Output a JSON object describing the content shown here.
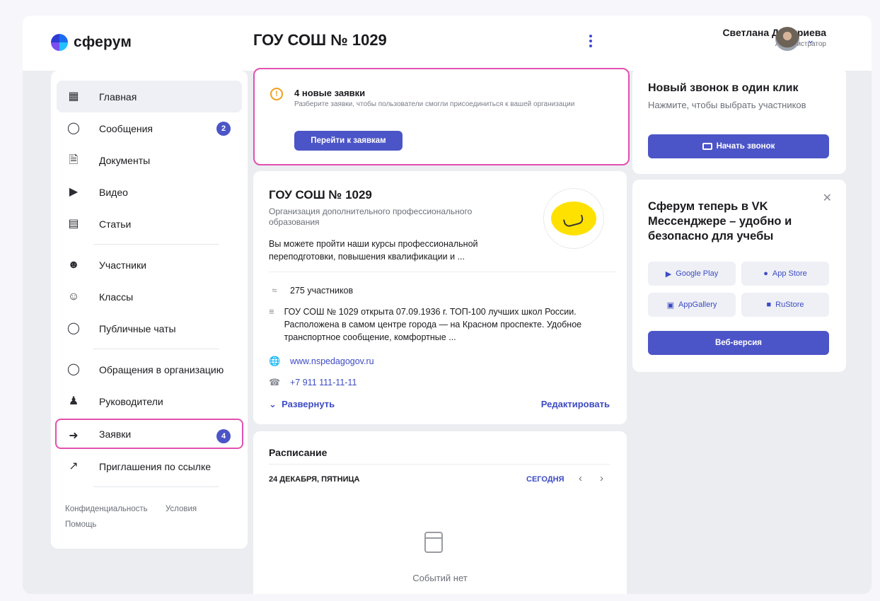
{
  "header": {
    "brand": "сферум",
    "org_title": "ГОУ СОШ № 1029",
    "user_name": "Светлана Дмитриева",
    "user_role": "Администратор"
  },
  "sidebar": {
    "items": [
      {
        "label": "Главная",
        "icon": "grid-icon"
      },
      {
        "label": "Сообщения",
        "icon": "chat-icon",
        "badge": "2"
      },
      {
        "label": "Документы",
        "icon": "document-icon"
      },
      {
        "label": "Видео",
        "icon": "play-icon"
      },
      {
        "label": "Статьи",
        "icon": "article-icon"
      },
      {
        "label": "Участники",
        "icon": "people-icon"
      },
      {
        "label": "Классы",
        "icon": "group-icon"
      },
      {
        "label": "Публичные чаты",
        "icon": "public-chat-icon"
      },
      {
        "label": "Обращения в организацию",
        "icon": "chat-icon"
      },
      {
        "label": "Руководители",
        "icon": "person-icon"
      },
      {
        "label": "Заявки",
        "icon": "person-arrow-icon",
        "badge": "4"
      },
      {
        "label": "Приглашения по ссылке",
        "icon": "arrow-circle-icon"
      }
    ],
    "footer": {
      "privacy": "Конфиденциальность",
      "terms": "Условия",
      "help": "Помощь"
    }
  },
  "requests": {
    "title": "4 новые заявки",
    "description": "Разберите заявки, чтобы пользователи смогли присоединиться к вашей организации",
    "button": "Перейти к заявкам"
  },
  "organization": {
    "name": "ГОУ СОШ № 1029",
    "type": "Организация дополнительного профессионального образования",
    "text": "Вы можете пройти наши курсы профессиональной переподготовки, повышения квалификации и ...",
    "members": "275 участников",
    "about": "ГОУ СОШ № 1029 открыта 07.09.1936 г. ТОП-100 лучших школ России. Расположена в самом центре города — на Красном проспекте. Удобное транспортное сообщение, комфортные ...",
    "website": "www.nspedagogov.ru",
    "phone": "+7 911 111-11-11",
    "expand": "Развернуть",
    "edit": "Редактировать"
  },
  "schedule": {
    "title": "Расписание",
    "date": "24 ДЕКАБРЯ, ПЯТНИЦА",
    "today": "СЕГОДНЯ",
    "empty": "Событий нет"
  },
  "call": {
    "title": "Новый звонок в один клик",
    "description": "Нажмите, чтобы выбрать участников",
    "button": "Начать звонок"
  },
  "promo": {
    "title": "Сферум теперь в VK Мессенджере – удобно и безопасно для учебы",
    "google_play": "Google Play",
    "app_store": "App Store",
    "app_gallery": "AppGallery",
    "rustore": "RuStore",
    "web": "Веб-версия"
  },
  "colors": {
    "accent": "#4c55c7",
    "highlight": "#e250b0",
    "warning": "#f0a020"
  }
}
